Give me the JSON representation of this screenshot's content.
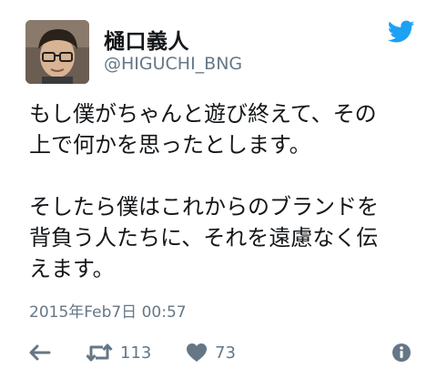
{
  "tweet": {
    "display_name": "樋口義人",
    "handle": "@HIGUCHI_BNG",
    "text_lines": [
      "もし僕がちゃんと遊び終えて、その",
      "上で何かを思ったとします。",
      "",
      "そしたら僕はこれからのブランドを",
      "背負う人たちに、それを遠慮なく伝",
      "えます。"
    ],
    "timestamp": "2015年Feb7日 00:57"
  },
  "actions": {
    "reply_icon": "reply-arrow-icon",
    "retweet_icon": "retweet-icon",
    "retweet_count": "113",
    "like_icon": "heart-icon",
    "like_count": "73",
    "info_icon": "info-icon"
  },
  "colors": {
    "brand": "#1da1f2",
    "text": "#14171a",
    "secondary": "#657786"
  }
}
